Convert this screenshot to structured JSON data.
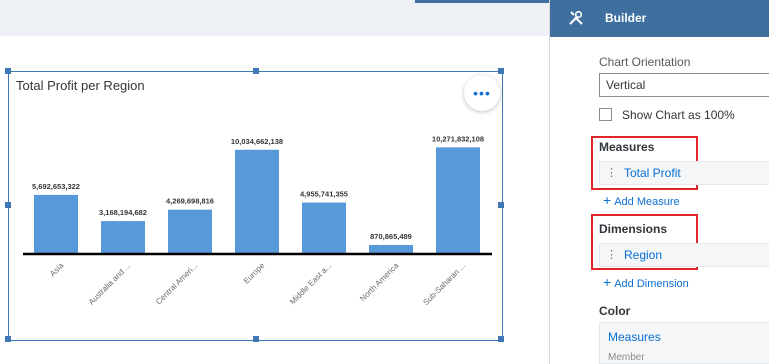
{
  "chart_widget": {
    "title": "Total Profit per Region",
    "more_label": "•••"
  },
  "chart_data": {
    "type": "bar",
    "title": "Total Profit per Region",
    "categories": [
      "Asia",
      "Australia and ...",
      "Central Ameri...",
      "Europe",
      "Middle East a...",
      "North America",
      "Sub-Saharan ..."
    ],
    "values": [
      5692653322,
      3168194682,
      4269698816,
      10034662138,
      4955741355,
      870865489,
      10271832108
    ],
    "value_labels": [
      "5,692,653,322",
      "3,168,194,682",
      "4,269,698,816",
      "10,034,662,138",
      "4,955,741,355",
      "870,865,489",
      "10,271,832,108"
    ],
    "ylim": [
      0,
      11000000000
    ],
    "grid": false,
    "legend": "none",
    "color": "#5899da"
  },
  "builder": {
    "title": "Builder",
    "orientation_label": "Chart Orientation",
    "orientation_value": "Vertical",
    "show_percent_label": "Show Chart as 100%",
    "measures_title": "Measures",
    "measure_item": "Total Profit",
    "add_measure": "Add Measure",
    "dimensions_title": "Dimensions",
    "dimension_item": "Region",
    "add_dimension": "Add Dimension",
    "color_title": "Color",
    "color_value": "Measures",
    "color_sub": "Member"
  }
}
